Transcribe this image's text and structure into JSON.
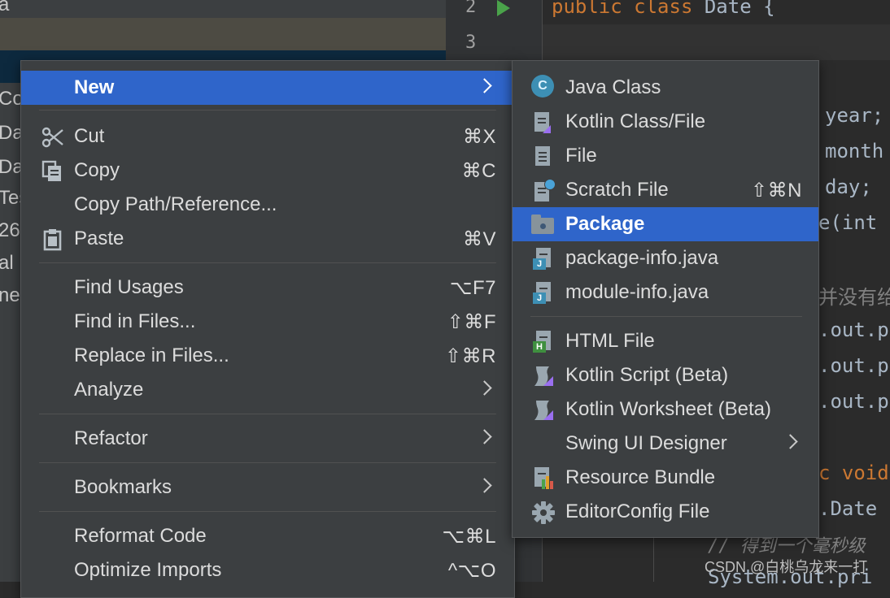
{
  "project_panel": {
    "partial_labels": [
      "a",
      "Co",
      "Dat",
      "Dat",
      "Tes",
      "26",
      "al I",
      "ne"
    ]
  },
  "editor": {
    "line_numbers": [
      "2",
      "3"
    ],
    "line2": {
      "kw1": "public",
      "kw2": "class",
      "name": "Date {"
    },
    "fragments": [
      "year;",
      "month",
      "day;",
      "e(int",
      "并没有给",
      ".out.p",
      ".out.p",
      ".out.p",
      "c void",
      ".Date"
    ],
    "comment": "// 得到一个毫秒级",
    "bottom_line": "System.out.pri"
  },
  "context_menu": {
    "items": [
      {
        "label": "New",
        "shortcut": "",
        "icon": "",
        "submenu": true,
        "selected": true
      },
      {
        "label": "Cut",
        "shortcut": "⌘X",
        "icon": "scissors-icon",
        "submenu": false
      },
      {
        "label": "Copy",
        "shortcut": "⌘C",
        "icon": "copy-icon",
        "submenu": false
      },
      {
        "label": "Copy Path/Reference...",
        "shortcut": "",
        "icon": "",
        "submenu": false
      },
      {
        "label": "Paste",
        "shortcut": "⌘V",
        "icon": "clipboard-icon",
        "submenu": false
      },
      {
        "label": "Find Usages",
        "shortcut": "⌥F7",
        "icon": "",
        "submenu": false
      },
      {
        "label": "Find in Files...",
        "shortcut": "⇧⌘F",
        "icon": "",
        "submenu": false
      },
      {
        "label": "Replace in Files...",
        "shortcut": "⇧⌘R",
        "icon": "",
        "submenu": false
      },
      {
        "label": "Analyze",
        "shortcut": "",
        "icon": "",
        "submenu": true
      },
      {
        "label": "Refactor",
        "shortcut": "",
        "icon": "",
        "submenu": true
      },
      {
        "label": "Bookmarks",
        "shortcut": "",
        "icon": "",
        "submenu": true
      },
      {
        "label": "Reformat Code",
        "shortcut": "⌥⌘L",
        "icon": "",
        "submenu": false
      },
      {
        "label": "Optimize Imports",
        "shortcut": "^⌥O",
        "icon": "",
        "submenu": false
      }
    ]
  },
  "new_submenu": {
    "items": [
      {
        "label": "Java Class",
        "shortcut": "",
        "icon": "java-class-icon",
        "icon_text": "C"
      },
      {
        "label": "Kotlin Class/File",
        "shortcut": "",
        "icon": "kotlin-file-icon"
      },
      {
        "label": "File",
        "shortcut": "",
        "icon": "file-icon"
      },
      {
        "label": "Scratch File",
        "shortcut": "⇧⌘N",
        "icon": "scratch-file-icon"
      },
      {
        "label": "Package",
        "shortcut": "",
        "icon": "package-folder-icon",
        "selected": true
      },
      {
        "label": "package-info.java",
        "shortcut": "",
        "icon": "java-file-icon",
        "icon_text": "J"
      },
      {
        "label": "module-info.java",
        "shortcut": "",
        "icon": "java-file-icon",
        "icon_text": "J"
      },
      {
        "label": "HTML File",
        "shortcut": "",
        "icon": "html-file-icon",
        "icon_text": "H"
      },
      {
        "label": "Kotlin Script (Beta)",
        "shortcut": "",
        "icon": "kotlin-script-icon"
      },
      {
        "label": "Kotlin Worksheet (Beta)",
        "shortcut": "",
        "icon": "kotlin-worksheet-icon"
      },
      {
        "label": "Swing UI Designer",
        "shortcut": "",
        "icon": "",
        "submenu": true
      },
      {
        "label": "Resource Bundle",
        "shortcut": "",
        "icon": "resource-bundle-icon"
      },
      {
        "label": "EditorConfig File",
        "shortcut": "",
        "icon": "gear-icon"
      }
    ]
  },
  "watermark": "CSDN @白桃乌龙来一打",
  "colors": {
    "selection": "#2f65ca",
    "menu_bg": "#3c3f41",
    "keyword": "#cc7832",
    "java_class_badge": "#3d8fb4",
    "kotlin_mark": "#9a6ff0"
  }
}
